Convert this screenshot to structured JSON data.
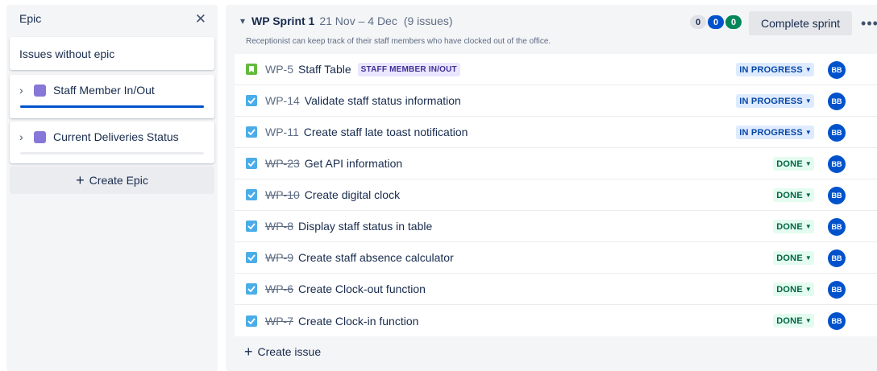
{
  "epic_panel": {
    "title": "Epic",
    "close_icon": "close-icon",
    "issues_without_epic": "Issues without epic",
    "epics": [
      {
        "name": "Staff Member In/Out",
        "progress": 1.0,
        "color": "#8777d9"
      },
      {
        "name": "Current Deliveries Status",
        "progress": 0.0,
        "color": "#8777d9"
      }
    ],
    "create_epic": "Create Epic"
  },
  "sprint": {
    "name": "WP Sprint 1",
    "dates": "21 Nov – 4 Dec",
    "issue_count": "(9 issues)",
    "goal": "Receptionist can keep track of their staff members who have clocked out of the office.",
    "counts": {
      "todo": "0",
      "in_progress": "0",
      "done": "0"
    },
    "complete_label": "Complete sprint",
    "more_label": "•••",
    "create_issue": "Create issue"
  },
  "issues": [
    {
      "key": "WP-5",
      "summary": "Staff Table",
      "type": "story",
      "struck": false,
      "epic_label": "STAFF MEMBER IN/OUT",
      "status": "IN PROGRESS",
      "status_kind": "inprog",
      "assignee": "BB"
    },
    {
      "key": "WP-14",
      "summary": "Validate staff status information",
      "type": "task",
      "struck": false,
      "epic_label": "",
      "status": "IN PROGRESS",
      "status_kind": "inprog",
      "assignee": "BB"
    },
    {
      "key": "WP-11",
      "summary": "Create staff late toast notification",
      "type": "task",
      "struck": false,
      "epic_label": "",
      "status": "IN PROGRESS",
      "status_kind": "inprog",
      "assignee": "BB"
    },
    {
      "key": "WP-23",
      "summary": "Get API information",
      "type": "task",
      "struck": true,
      "epic_label": "",
      "status": "DONE",
      "status_kind": "done",
      "assignee": "BB"
    },
    {
      "key": "WP-10",
      "summary": "Create digital clock",
      "type": "task",
      "struck": true,
      "epic_label": "",
      "status": "DONE",
      "status_kind": "done",
      "assignee": "BB"
    },
    {
      "key": "WP-8",
      "summary": "Display staff status in table",
      "type": "task",
      "struck": true,
      "epic_label": "",
      "status": "DONE",
      "status_kind": "done",
      "assignee": "BB"
    },
    {
      "key": "WP-9",
      "summary": "Create staff absence calculator",
      "type": "task",
      "struck": true,
      "epic_label": "",
      "status": "DONE",
      "status_kind": "done",
      "assignee": "BB"
    },
    {
      "key": "WP-6",
      "summary": "Create Clock-out function",
      "type": "task",
      "struck": true,
      "epic_label": "",
      "status": "DONE",
      "status_kind": "done",
      "assignee": "BB"
    },
    {
      "key": "WP-7",
      "summary": "Create Clock-in function",
      "type": "task",
      "struck": true,
      "epic_label": "",
      "status": "DONE",
      "status_kind": "done",
      "assignee": "BB"
    }
  ]
}
